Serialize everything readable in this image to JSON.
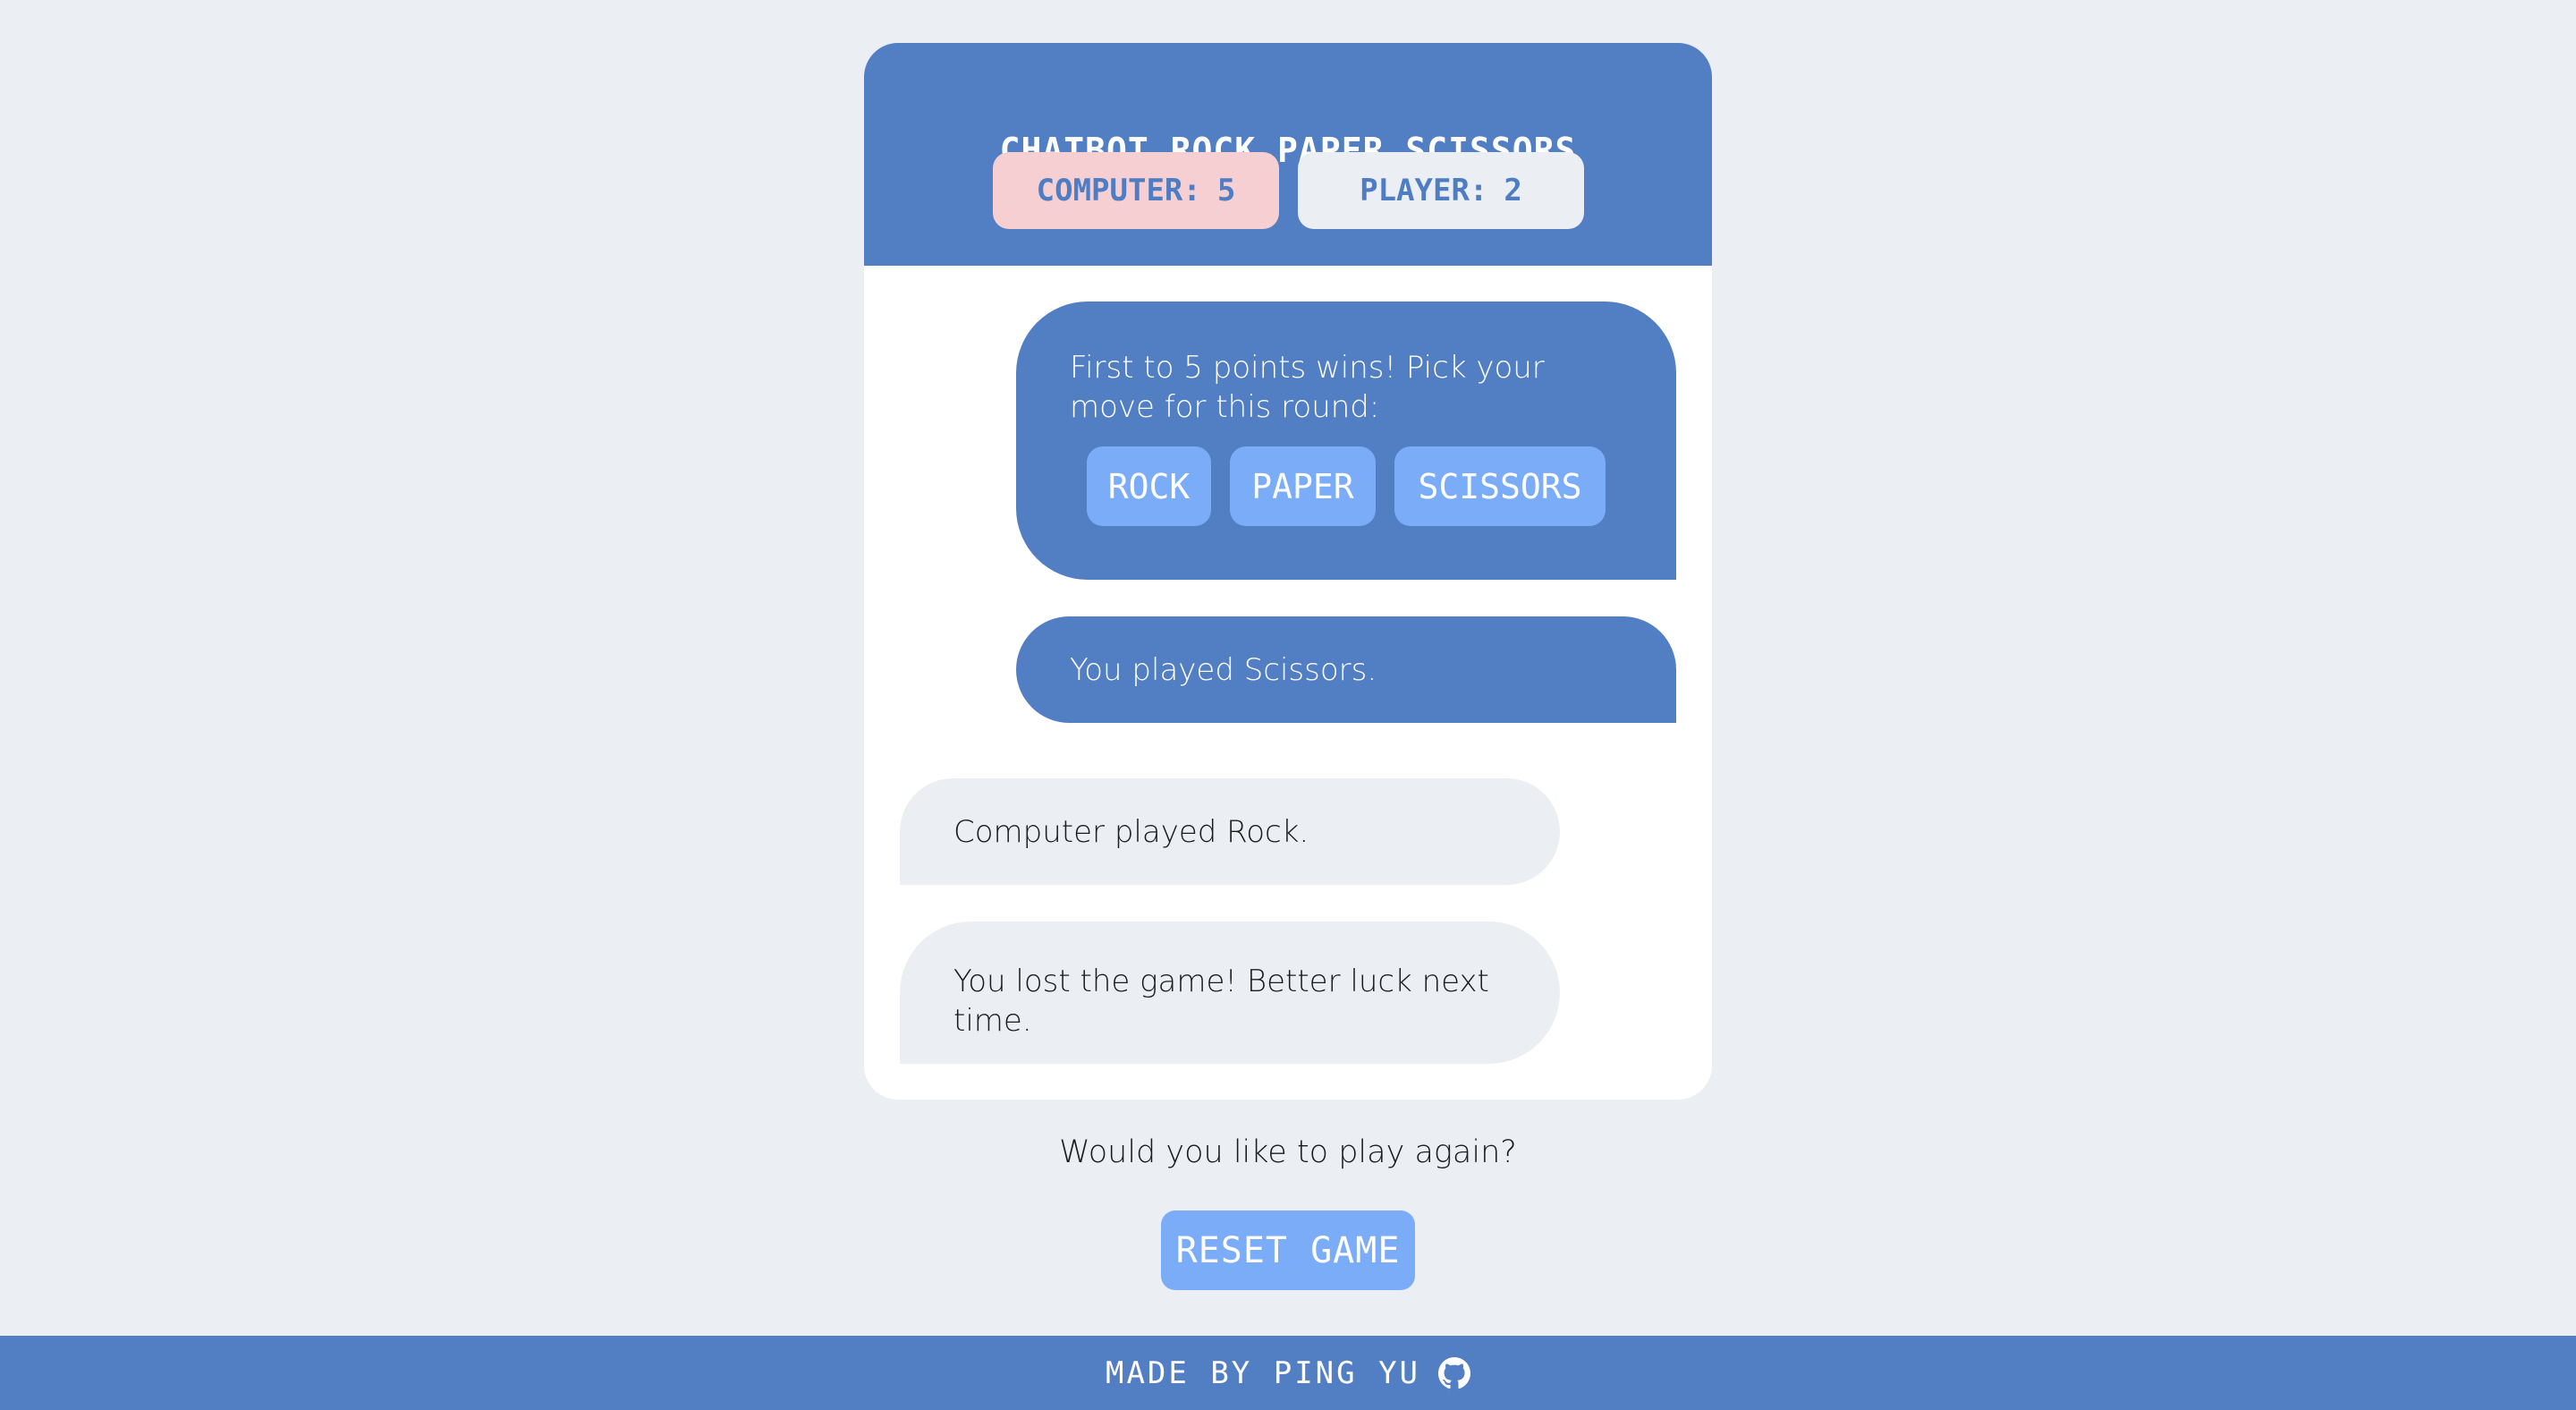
{
  "header": {
    "title": "CHATBOT ROCK PAPER SCISSORS",
    "computer_score_label": "COMPUTER:",
    "computer_score": "5",
    "player_score_label": "PLAYER:",
    "player_score": "2"
  },
  "chat": {
    "prompt_message": "First to 5 points wins! Pick your move for this round:",
    "moves": [
      "ROCK",
      "PAPER",
      "SCISSORS"
    ],
    "player_move_message": "You played Scissors.",
    "computer_move_message": "Computer played Rock.",
    "result_message": "You lost the game! Better luck next time."
  },
  "play_again_text": "Would you like to play again?",
  "reset_label": "RESET GAME",
  "footer": {
    "credit": "MADE BY PING YU",
    "icon": "github-icon"
  },
  "colors": {
    "primary": "#527ec3",
    "button": "#7aacf7",
    "computer_score_bg": "#f5cfd1",
    "background": "#ebeff4"
  }
}
